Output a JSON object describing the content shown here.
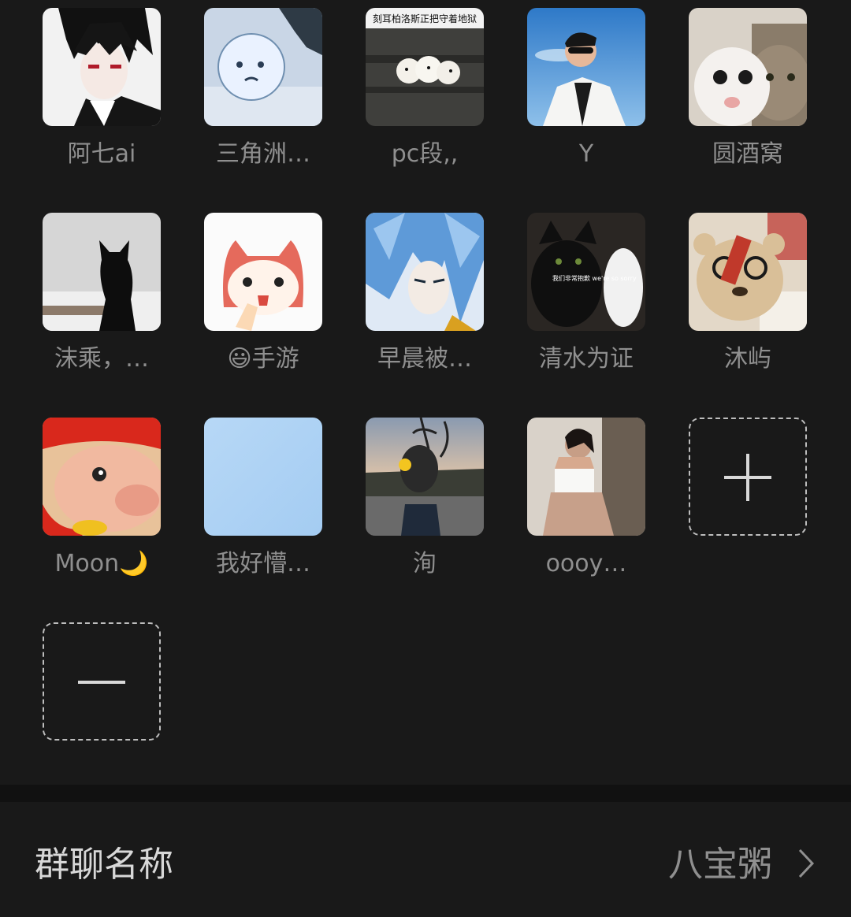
{
  "members": [
    {
      "name": "阿七ai",
      "avatar": "anime-boy-avatar"
    },
    {
      "name": "三角洲…",
      "avatar": "cartoon-snow-avatar"
    },
    {
      "name": "pc段,,",
      "avatar": "puppies-meme-avatar",
      "avatar_caption": "刻耳柏洛斯正把守着地狱"
    },
    {
      "name": "Y",
      "avatar": "man-sunglasses-avatar"
    },
    {
      "name": "圆酒窝",
      "avatar": "cats-avatar"
    },
    {
      "name": "沫乘，…",
      "avatar": "black-cat-snow-avatar"
    },
    {
      "name": "😃手游",
      "avatar": "cartoon-fox-avatar"
    },
    {
      "name": "早晨被…",
      "avatar": "blue-hair-anime-avatar"
    },
    {
      "name": "清水为证",
      "avatar": "cats-sorry-meme-avatar",
      "avatar_caption": "我们非常抱歉 we're so sorry"
    },
    {
      "name": "沐屿",
      "avatar": "teddy-bear-avatar"
    },
    {
      "name": "Moon🌙",
      "avatar": "cartoon-pig-avatar"
    },
    {
      "name": "我好懵…",
      "avatar": "light-blue-avatar"
    },
    {
      "name": "洵",
      "avatar": "hand-flower-avatar"
    },
    {
      "name": "oooy…",
      "avatar": "woman-photo-avatar"
    }
  ],
  "actions": {
    "add": {
      "icon": "plus-icon"
    },
    "remove": {
      "icon": "minus-icon"
    }
  },
  "group_name_row": {
    "label": "群聊名称",
    "value": "八宝粥",
    "icon": "chevron-right-icon"
  },
  "colors": {
    "background": "#191919",
    "separator": "#111111",
    "member_name": "#8f8f8f",
    "row_label": "#d8d8d8"
  }
}
